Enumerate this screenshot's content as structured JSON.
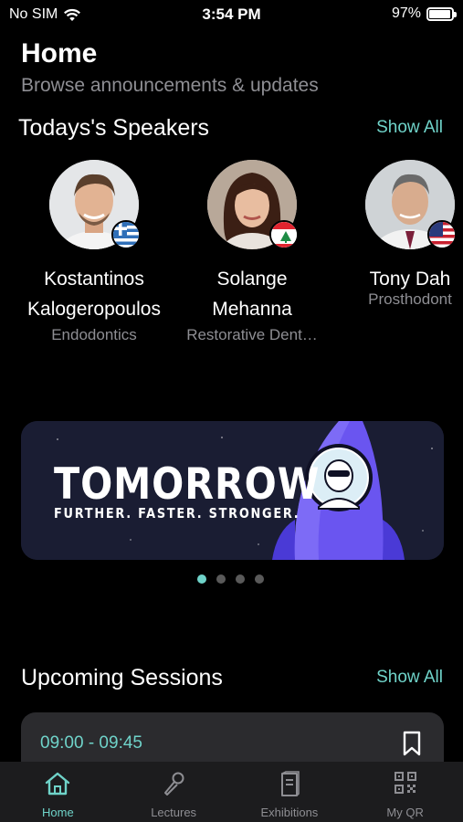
{
  "status_bar": {
    "carrier": "No SIM",
    "time": "3:54 PM",
    "battery": "97%",
    "battery_level": 0.97
  },
  "header": {
    "title": "Home",
    "subtitle": "Browse announcements & updates"
  },
  "speakers_section": {
    "title": "Todays's Speakers",
    "show_all": "Show All",
    "speakers": [
      {
        "name_line1": "Kostantinos",
        "name_line2": "Kalogeropoulos",
        "specialty": "Endodontics",
        "flag": "greece"
      },
      {
        "name_line1": "Solange",
        "name_line2": "Mehanna",
        "specialty": "Restorative Dent…",
        "flag": "lebanon"
      },
      {
        "name_line1": "Tony Dah",
        "name_line2": "",
        "specialty": "Prosthodont",
        "flag": "usa"
      }
    ]
  },
  "banner": {
    "title": "TOMORROW",
    "tagline": "FURTHER. FASTER. STRONGER.",
    "active_slide": 1,
    "slide_count": 4
  },
  "sessions_section": {
    "title": "Upcoming Sessions",
    "show_all": "Show All",
    "sessions": [
      {
        "time": "09:00 - 09:45"
      }
    ]
  },
  "tabs": [
    {
      "label": "Home",
      "icon": "home-icon",
      "active": true
    },
    {
      "label": "Lectures",
      "icon": "microphone-icon",
      "active": false
    },
    {
      "label": "Exhibitions",
      "icon": "booklet-icon",
      "active": false
    },
    {
      "label": "My QR",
      "icon": "qr-code-icon",
      "active": false
    }
  ],
  "colors": {
    "accent": "#6fd3c9",
    "background": "#000000",
    "card": "#2b2b2e",
    "tabbar": "#1c1c1e"
  }
}
